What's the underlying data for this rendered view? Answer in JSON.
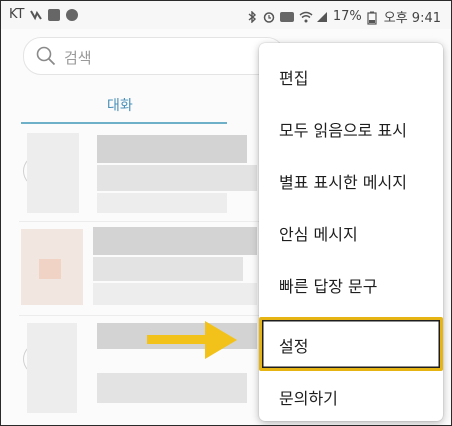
{
  "status_bar": {
    "carrier": "KT",
    "battery": "17%",
    "time": "오후 9:41"
  },
  "search": {
    "placeholder": "검색"
  },
  "tabs": [
    {
      "label": "대화"
    }
  ],
  "menu": {
    "items": [
      {
        "label": "편집"
      },
      {
        "label": "모두 읽음으로 표시"
      },
      {
        "label": "별표 표시한 메시지"
      },
      {
        "label": "안심 메시지"
      },
      {
        "label": "빠른 답장 문구"
      },
      {
        "label": "설정",
        "highlighted": true
      },
      {
        "label": "문의하기"
      }
    ]
  },
  "colors": {
    "accent": "#4a90b8",
    "highlight_border": "#e6b514",
    "arrow": "#f2c21b"
  },
  "icons": [
    "search-icon",
    "arrow-right-icon",
    "bluetooth-icon",
    "alarm-icon",
    "wifi-icon",
    "signal-icon",
    "battery-icon"
  ]
}
